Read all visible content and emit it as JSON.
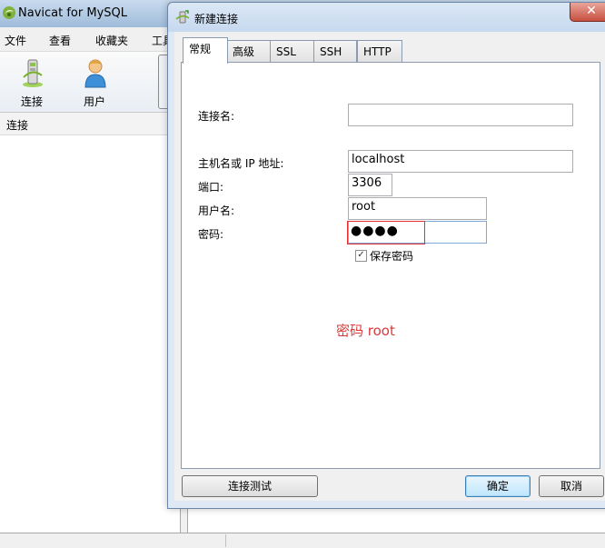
{
  "app": {
    "title": "Navicat for MySQL",
    "menu": [
      "文件",
      "查看",
      "收藏夹",
      "工具"
    ],
    "toolbar": [
      {
        "label": "连接",
        "icon": "connection-icon"
      },
      {
        "label": "用户",
        "icon": "user-icon"
      }
    ],
    "panel_header": "连接"
  },
  "dialog": {
    "title": "新建连接",
    "close_label": "✕",
    "tabs": [
      "常规",
      "高级",
      "SSL",
      "SSH",
      "HTTP"
    ],
    "active_tab": "常规",
    "fields": {
      "connection_name": {
        "label": "连接名:",
        "value": ""
      },
      "host": {
        "label": "主机名或 IP 地址:",
        "value": "localhost"
      },
      "port": {
        "label": "端口:",
        "value": "3306"
      },
      "username": {
        "label": "用户名:",
        "value": "root"
      },
      "password": {
        "label": "密码:",
        "masked_value": "●●●●"
      }
    },
    "save_password": {
      "label": "保存密码",
      "checked": true,
      "check_glyph": "✓"
    },
    "annotation": "密码 root",
    "buttons": {
      "test": "连接测试",
      "ok": "确定",
      "cancel": "取消"
    },
    "colors": {
      "annotation": "#d83a3a",
      "highlight_box": "#e03030",
      "focus_border": "#7ea8d6"
    }
  }
}
